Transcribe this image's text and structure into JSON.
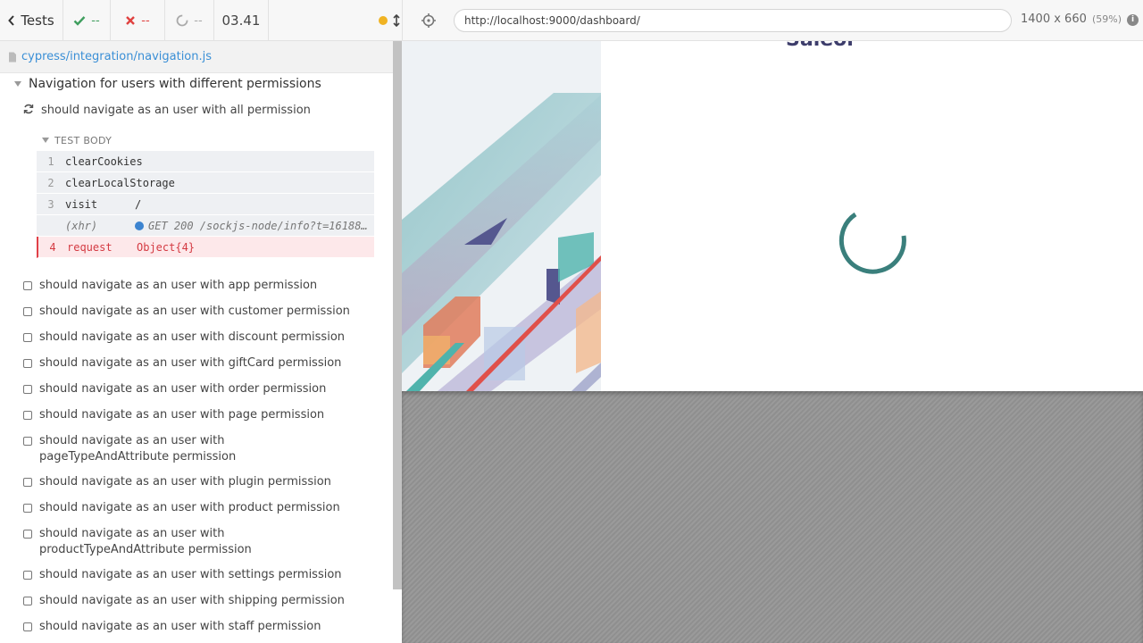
{
  "stats": {
    "back_label": "Tests",
    "passed": "--",
    "failed": "--",
    "pending": "--",
    "duration": "03.41"
  },
  "spec": {
    "path": "cypress/integration/navigation.js"
  },
  "suite": {
    "title": "Navigation for users with different permissions",
    "running_test": "should navigate as an user with all permission",
    "test_body_label": "TEST BODY",
    "commands": [
      {
        "num": "1",
        "name": "clearCookies",
        "message": ""
      },
      {
        "num": "2",
        "name": "clearLocalStorage",
        "message": ""
      },
      {
        "num": "3",
        "name": "visit",
        "message": "/"
      },
      {
        "num": "",
        "name": "(xhr)",
        "message": "GET 200 /sockjs-node/info?t=161883..."
      },
      {
        "num": "4",
        "name": "request",
        "message": "Object{4}"
      }
    ],
    "tests": [
      "should navigate as an user with app permission",
      "should navigate as an user with customer permission",
      "should navigate as an user with discount permission",
      "should navigate as an user with giftCard permission",
      "should navigate as an user with order permission",
      "should navigate as an user with page permission",
      "should navigate as an user with pageTypeAndAttribute permission",
      "should navigate as an user with plugin permission",
      "should navigate as an user with product permission",
      "should navigate as an user with productTypeAndAttribute permission",
      "should navigate as an user with settings permission",
      "should navigate as an user with shipping permission",
      "should navigate as an user with staff permission"
    ]
  },
  "aut": {
    "url": "http://localhost:9000/dashboard/",
    "viewport": "1400 x 660",
    "scale": "(59%)",
    "partial_title": "Saleor"
  },
  "colors": {
    "pass": "#3f9e5e",
    "fail": "#e0413f",
    "running": "#f0b323",
    "spinner": "#3a7f7c",
    "link": "#3a8fd6"
  },
  "icons": {
    "back": "chevron-left-icon",
    "passed": "check-icon",
    "failed": "x-icon",
    "pending": "circle-notch-icon",
    "running": "running-dot-icon",
    "auto_scroll": "arrows-vertical-icon",
    "stop": "stop-icon",
    "selector": "crosshair-icon",
    "info": "info-icon",
    "file": "file-icon"
  }
}
